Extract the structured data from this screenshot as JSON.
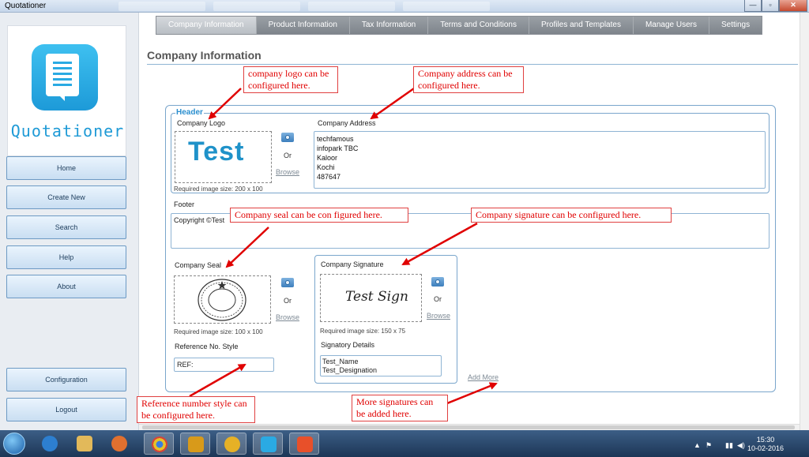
{
  "window": {
    "title": "Quotationer",
    "controls": {
      "minimize": "—",
      "maximize": "▫",
      "close": "✕"
    }
  },
  "sidebar": {
    "brand": "Quotationer",
    "items": [
      {
        "label": "Home"
      },
      {
        "label": "Create New"
      },
      {
        "label": "Search"
      },
      {
        "label": "Help"
      },
      {
        "label": "About"
      }
    ],
    "bottom_items": [
      {
        "label": "Configuration"
      },
      {
        "label": "Logout"
      }
    ]
  },
  "tabs": [
    {
      "label": "Company Information",
      "active": true
    },
    {
      "label": "Product Information"
    },
    {
      "label": "Tax Information"
    },
    {
      "label": "Terms and Conditions"
    },
    {
      "label": "Profiles and Templates"
    },
    {
      "label": "Manage Users"
    },
    {
      "label": "Settings"
    }
  ],
  "page": {
    "title": "Company Information",
    "header_legend": "Header",
    "company_logo": {
      "label": "Company Logo",
      "preview_text": "Test",
      "or": "Or",
      "browse": "Browse",
      "hint": "Required image size: 200 x 100"
    },
    "company_address": {
      "label": "Company Address",
      "lines": [
        "techfamous",
        "infopark TBC",
        "Kaloor",
        "Kochi",
        "487647"
      ]
    },
    "footer": {
      "label": "Footer",
      "value": "Copyright ©Test"
    },
    "company_seal": {
      "label": "Company Seal",
      "or": "Or",
      "browse": "Browse",
      "hint": "Required image size: 100 x 100"
    },
    "reference": {
      "label": "Reference No. Style",
      "value": "REF:"
    },
    "company_signature": {
      "label": "Company Signature",
      "preview_text": "Test Sign",
      "or": "Or",
      "browse": "Browse",
      "hint": "Required image size: 150 x 75",
      "signatory_label": "Signatory Details",
      "signatory_lines": [
        "Test_Name",
        "Test_Designation"
      ]
    },
    "add_more": "Add More"
  },
  "annotations": {
    "logo": "company logo can be configured here.",
    "address": "Company address can be configured here.",
    "seal": "Company seal can be con figured here.",
    "signature": "Company signature can be configured here.",
    "reference": "Reference number style can be configured here.",
    "more_signatures": "More signatures can be added here."
  },
  "taskbar": {
    "time": "15:30",
    "date": "10-02-2016"
  },
  "colors": {
    "accent": "#2b8fcf",
    "callout": "#e00000",
    "tab_bar": "#8a9097"
  }
}
